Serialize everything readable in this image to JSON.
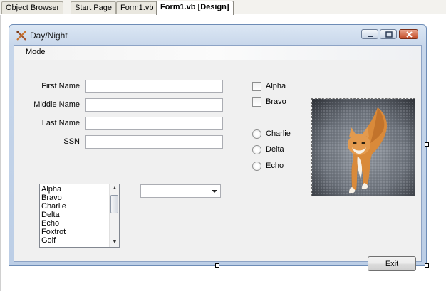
{
  "document_tabs": [
    {
      "label": "Object Browser",
      "active": false
    },
    {
      "label": "Start Page",
      "active": false
    },
    {
      "label": "Form1.vb",
      "active": false
    },
    {
      "label": "Form1.vb [Design]",
      "active": true
    }
  ],
  "form": {
    "title": "Day/Night",
    "menu": [
      "Mode"
    ],
    "fields": {
      "first_name": {
        "label": "First Name",
        "value": ""
      },
      "middle_name": {
        "label": "Middle Name",
        "value": ""
      },
      "last_name": {
        "label": "Last Name",
        "value": ""
      },
      "ssn": {
        "label": "SSN",
        "value": ""
      }
    },
    "listbox_items": [
      "Alpha",
      "Bravo",
      "Charlie",
      "Delta",
      "Echo",
      "Foxtrot",
      "Golf"
    ],
    "combobox": {
      "selected": ""
    },
    "checkboxes": [
      {
        "label": "Alpha",
        "checked": false
      },
      {
        "label": "Bravo",
        "checked": false
      }
    ],
    "radios": [
      {
        "label": "Charlie",
        "selected": false
      },
      {
        "label": "Delta",
        "selected": false
      },
      {
        "label": "Echo",
        "selected": false
      }
    ],
    "exit_label": "Exit"
  },
  "icons": {
    "form_icon": "crossed-tools-icon",
    "minimize": "minimize-icon",
    "maximize": "maximize-icon",
    "close": "close-icon",
    "scroll_up": "scroll-up-arrow-icon",
    "scroll_down": "scroll-down-arrow-icon",
    "dropdown": "chevron-down-icon"
  },
  "colors": {
    "close_button": "#c24a26",
    "form_frame": "#bccee6",
    "client_bg": "#f0f0f0"
  }
}
